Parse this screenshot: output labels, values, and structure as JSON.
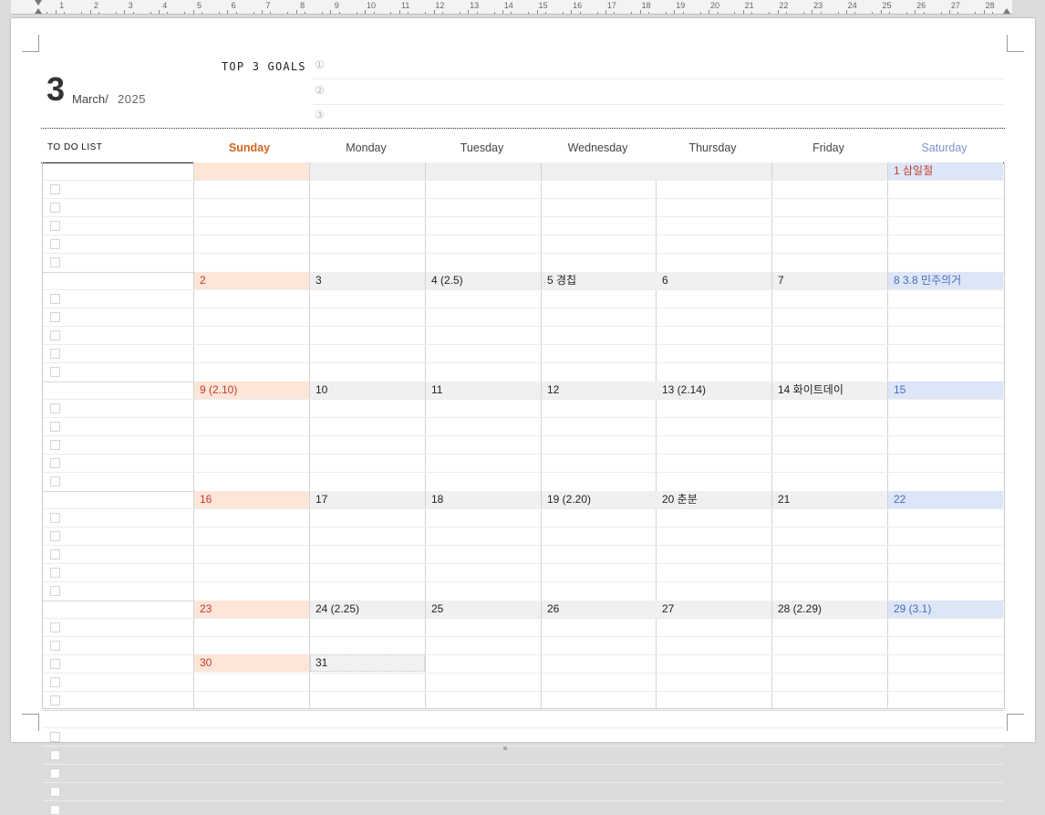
{
  "ruler": {
    "labels": [
      "1",
      "2",
      "3",
      "4",
      "5",
      "6",
      "7",
      "8",
      "9",
      "10",
      "11",
      "12",
      "13",
      "14",
      "15",
      "16",
      "17",
      "18",
      "19",
      "20",
      "21",
      "22",
      "23",
      "24",
      "25",
      "26",
      "27",
      "28"
    ]
  },
  "header": {
    "month_number": "3",
    "month_name": "March/",
    "year": "2025",
    "goals_title": "TOP 3 GOALS",
    "goal_markers": [
      "①",
      "②",
      "③"
    ]
  },
  "todo_title": "TO DO LIST",
  "weekdays": [
    "Sunday",
    "Monday",
    "Tuesday",
    "Wednesday",
    "Thursday",
    "Friday",
    "Saturday"
  ],
  "colors": {
    "sunday": "#d1651f",
    "saturday": "#7b92c9",
    "sunday_bar": "#fde5d8",
    "saturday_bar": "#dde6f7",
    "holiday_text": "#c43c2f"
  },
  "weeks": [
    [
      "",
      "",
      "",
      "",
      "",
      "",
      "1  삼일절"
    ],
    [
      "2",
      "3",
      "4  (2.5)",
      "5  경칩",
      "6",
      "7",
      "8  3.8  민주의거"
    ],
    [
      "9  (2.10)",
      "10",
      "11",
      "12",
      "13  (2.14)",
      "14  화이트데이",
      "15"
    ],
    [
      "16",
      "17",
      "18",
      "19  (2.20)",
      "20  춘분",
      "21",
      "22"
    ],
    [
      "23",
      "24  (2.25)",
      "25",
      "26",
      "27",
      "28  (2.29)",
      "29  (3.1)"
    ],
    [
      "30",
      "31",
      "",
      "",
      "",
      "",
      ""
    ]
  ]
}
